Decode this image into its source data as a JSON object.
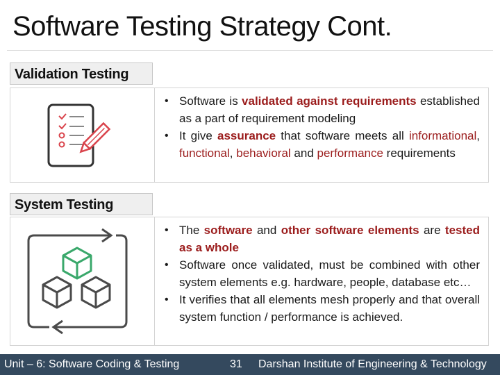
{
  "title": "Software Testing Strategy Cont.",
  "sections": [
    {
      "heading": "Validation Testing",
      "icon": "checklist-pencil-icon",
      "bullets": [
        {
          "parts": [
            {
              "text": "Software is ",
              "style": "normal"
            },
            {
              "text": "validated against requirements",
              "style": "bold-red"
            },
            {
              "text": " established as a part of requirement modeling",
              "style": "normal"
            }
          ]
        },
        {
          "parts": [
            {
              "text": "It give ",
              "style": "normal"
            },
            {
              "text": "assurance",
              "style": "bold-red"
            },
            {
              "text": " that software meets all ",
              "style": "normal"
            },
            {
              "text": "informational",
              "style": "red"
            },
            {
              "text": ", ",
              "style": "normal"
            },
            {
              "text": "functional",
              "style": "red"
            },
            {
              "text": ", ",
              "style": "normal"
            },
            {
              "text": "behavioral",
              "style": "red"
            },
            {
              "text": " and ",
              "style": "normal"
            },
            {
              "text": "performance",
              "style": "red"
            },
            {
              "text": " requirements",
              "style": "normal"
            }
          ]
        }
      ]
    },
    {
      "heading": "System Testing",
      "icon": "cubes-cycle-icon",
      "bullets": [
        {
          "parts": [
            {
              "text": "The ",
              "style": "normal"
            },
            {
              "text": "software",
              "style": "bold-red"
            },
            {
              "text": " and ",
              "style": "normal"
            },
            {
              "text": "other software elements",
              "style": "bold-red"
            },
            {
              "text": " are ",
              "style": "normal"
            },
            {
              "text": "tested as a whole",
              "style": "bold-red"
            }
          ]
        },
        {
          "parts": [
            {
              "text": "Software once validated, must be combined with other system elements e.g. hardware, people, database etc…",
              "style": "normal"
            }
          ]
        },
        {
          "parts": [
            {
              "text": "It verifies that all elements mesh properly and that overall system function / performance is achieved.",
              "style": "normal"
            }
          ]
        }
      ]
    }
  ],
  "footer": {
    "unit": "Unit – 6: Software Coding & Testing",
    "page_number": "31",
    "institute": "Darshan Institute of Engineering & Technology"
  },
  "colors": {
    "accent_red": "#9b1c1c",
    "footer_bg": "#34495e",
    "icon_green": "#3aa86b",
    "icon_red": "#d9434b",
    "icon_dark": "#444444"
  }
}
